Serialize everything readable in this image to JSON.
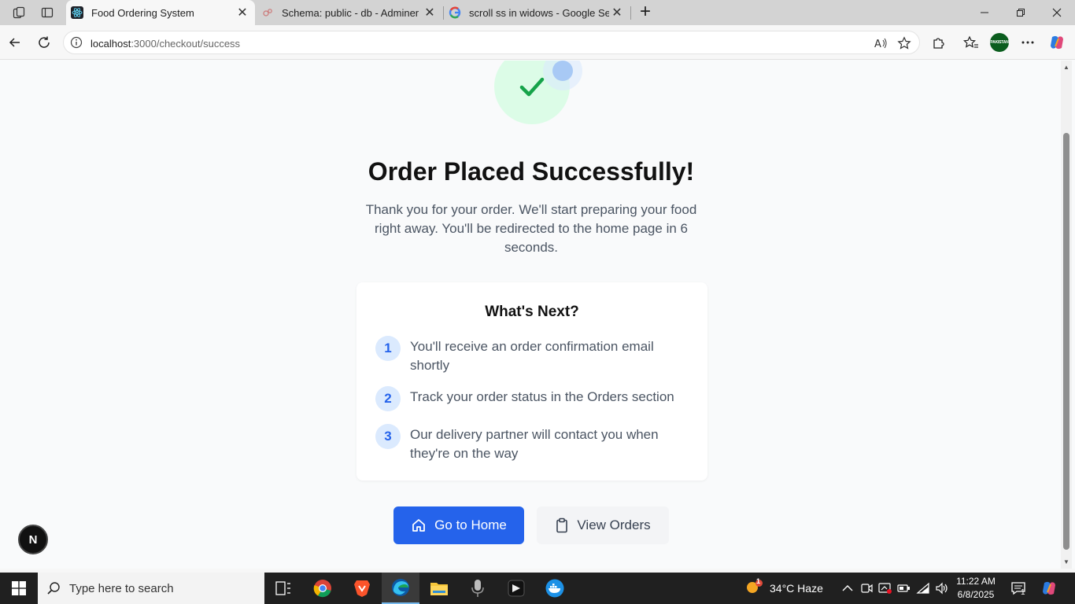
{
  "browser": {
    "tabs": [
      {
        "title": "Food Ordering System",
        "active": true
      },
      {
        "title": "Schema: public - db - Adminer",
        "active": false
      },
      {
        "title": "scroll ss in widows - Google Search",
        "active": false
      }
    ],
    "url_host": "localhost",
    "url_rest": ":3000/checkout/success",
    "profile_badge": "PAKISTAN"
  },
  "page": {
    "title": "Order Placed Successfully!",
    "message": "Thank you for your order. We'll start preparing your food right away. You'll be redirected to the home page in 6 seconds.",
    "next_card": {
      "title": "What's Next?",
      "steps": [
        {
          "num": "1",
          "text": "You'll receive an order confirmation email shortly"
        },
        {
          "num": "2",
          "text": "Track your order status in the Orders section"
        },
        {
          "num": "3",
          "text": "Our delivery partner will contact you when they're on the way"
        }
      ]
    },
    "buttons": {
      "home": "Go to Home",
      "orders": "View Orders"
    },
    "dev_badge": "N"
  },
  "taskbar": {
    "search_placeholder": "Type here to search",
    "weather": "34°C  Haze",
    "weather_alert": "1",
    "time": "11:22 AM",
    "date": "6/8/2025",
    "notifications": "1"
  },
  "colors": {
    "primary": "#2563eb",
    "success_bg": "#dcfce7",
    "success_check": "#16a34a",
    "step_bg": "#dbeafe"
  }
}
